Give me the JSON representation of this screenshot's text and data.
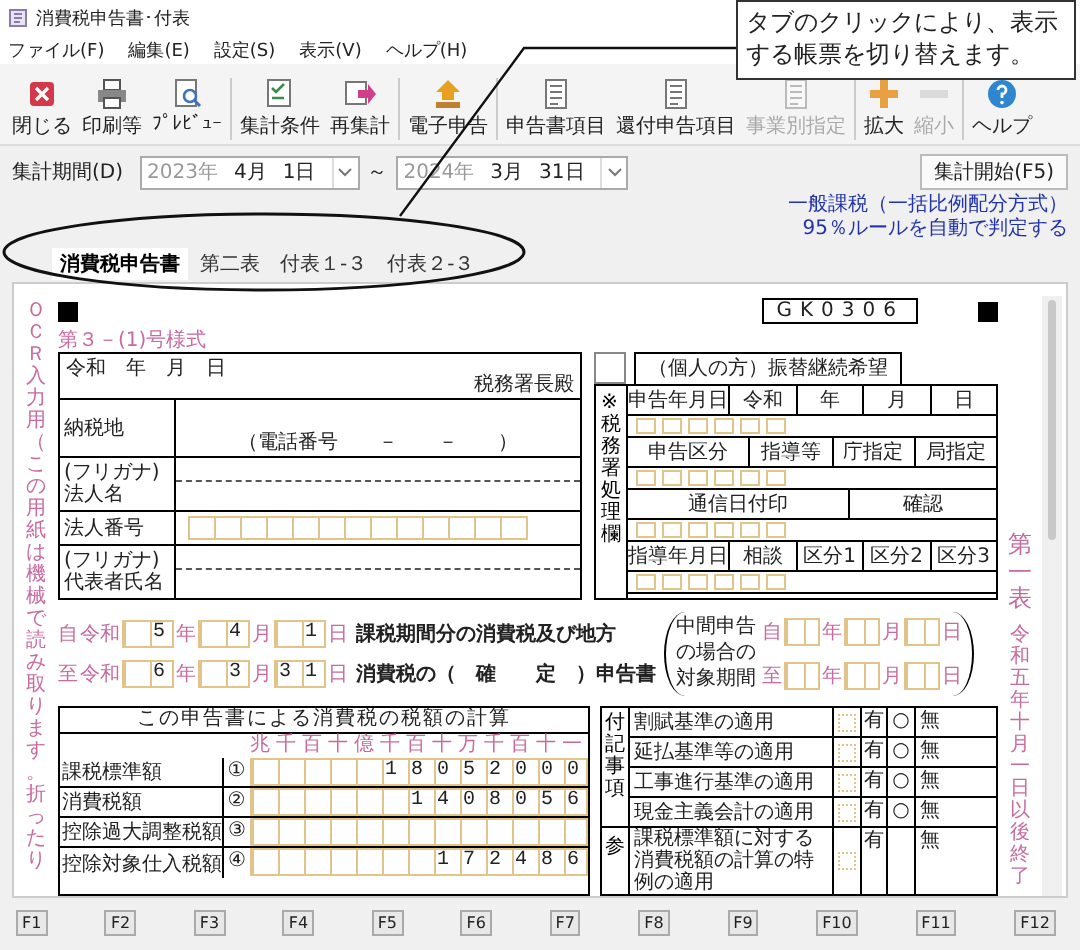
{
  "window": {
    "title": "消費税申告書･付表"
  },
  "menu": [
    "ファイル(F)",
    "編集(E)",
    "設定(S)",
    "表示(V)",
    "ヘルプ(H)"
  ],
  "toolbar": [
    [
      {
        "label": "閉じる",
        "kind": "close",
        "disabled": false
      },
      {
        "label": "印刷等",
        "kind": "printer",
        "disabled": false
      },
      {
        "label": "ﾌﾟﾚﾋﾞｭｰ",
        "kind": "preview",
        "disabled": false
      }
    ],
    [
      {
        "label": "集計条件",
        "kind": "settings",
        "disabled": false
      },
      {
        "label": "再集計",
        "kind": "recalc",
        "disabled": false
      }
    ],
    [
      {
        "label": "電子申告",
        "kind": "upload",
        "disabled": false
      }
    ],
    [
      {
        "label": "申告書項目",
        "kind": "list",
        "disabled": false
      },
      {
        "label": "還付申告項目",
        "kind": "list",
        "disabled": false
      },
      {
        "label": "事業別指定",
        "kind": "list",
        "disabled": true
      }
    ],
    [
      {
        "label": "拡大",
        "kind": "plus",
        "disabled": false
      },
      {
        "label": "縮小",
        "kind": "minus",
        "disabled": true
      }
    ],
    [
      {
        "label": "ヘルプ",
        "kind": "help",
        "disabled": false
      }
    ]
  ],
  "period": {
    "label": "集計期間(D)",
    "from": {
      "year": "2023年",
      "month": "4月",
      "day": "1日"
    },
    "separator": "～",
    "to": {
      "year": "2024年",
      "month": "3月",
      "day": "31日"
    }
  },
  "aggregate_button": "集計開始(F5)",
  "mode_note": [
    "一般課税（一括比例配分方式）",
    "95％ルールを自動で判定する"
  ],
  "tabs": [
    {
      "label": "消費税申告書",
      "selected": true
    },
    {
      "label": "第二表",
      "selected": false
    },
    {
      "label": "付表１-３",
      "selected": false
    },
    {
      "label": "付表２-３",
      "selected": false
    }
  ],
  "callout": [
    "タブのクリックにより、表示",
    "する帳票を切り替えます。"
  ],
  "form": {
    "code": "GK0306",
    "form_number": "第３－(1)号様式",
    "ocr_note": "ＯＣＲ入力用（この用紙は機械で読み取ります。折ったり",
    "side_title": "第一表",
    "side_period": "令和五年十月一日以後終了",
    "filer": {
      "date_label": "令和　年　月　日",
      "office_suffix": "税務署長殿",
      "rows": [
        {
          "kind": "address",
          "label": "納税地",
          "note": "（電話番号　　－　　－　　）"
        },
        {
          "kind": "name",
          "kana": "(フリガナ)",
          "label": "法人名"
        },
        {
          "kind": "number",
          "label": "法人番号"
        },
        {
          "kind": "name",
          "kana": "(フリガナ)",
          "label": "代表者氏名"
        }
      ]
    },
    "office": {
      "transfer": "（個人の方）振替継続希望",
      "side": "※税務署処理欄",
      "sections": [
        {
          "cells": [
            "申告年月日",
            "令和",
            "年",
            "月",
            "日"
          ]
        },
        {
          "cells": [
            "申告区分",
            "指導等",
            "庁指定",
            "局指定"
          ]
        },
        {
          "cells": [
            "通信日付印",
            "確認"
          ]
        },
        {
          "cells": [
            "指導年月日",
            "相談",
            "区分1",
            "区分2",
            "区分3"
          ]
        }
      ]
    },
    "period": [
      {
        "prefix": "自",
        "era": "令和",
        "parts": [
          {
            "value": "5",
            "unit": "年"
          },
          {
            "value": "4",
            "unit": "月"
          },
          {
            "value": "1",
            "unit": "日"
          }
        ]
      },
      {
        "prefix": "至",
        "era": "令和",
        "parts": [
          {
            "value": "6",
            "unit": "年"
          },
          {
            "value": "3",
            "unit": "月"
          },
          {
            "value": "31",
            "unit": "日"
          }
        ]
      }
    ],
    "title_lines": [
      "課税期間分の消費税及び地方",
      "消費税の（　確　　定　）申告書"
    ],
    "interim": {
      "labels": [
        "中間申告",
        "の場合の",
        "対象期間"
      ],
      "rows": [
        {
          "prefix": "自",
          "units": [
            "年",
            "月",
            "日"
          ]
        },
        {
          "prefix": "至",
          "units": [
            "年",
            "月",
            "日"
          ]
        }
      ]
    },
    "calc": {
      "title": "この申告書による消費税の税額の計算",
      "units": "兆千百十億千百十万千百十一",
      "rows": [
        {
          "label": "課税標準額",
          "mark": "①",
          "value": "18052000"
        },
        {
          "label": "消費税額",
          "mark": "②",
          "value": "1408056"
        },
        {
          "label": "控除過大調整税額",
          "mark": "③",
          "value": ""
        },
        {
          "label": "控除対象仕入税額",
          "mark": "④",
          "value": "172486"
        }
      ]
    },
    "notes": {
      "side": "付記事項",
      "reference_side": "参",
      "rows": [
        {
          "label": "割賦基準の適用",
          "yes": "有",
          "mark": "○",
          "no": "無"
        },
        {
          "label": "延払基準等の適用",
          "yes": "有",
          "mark": "○",
          "no": "無"
        },
        {
          "label": "工事進行基準の適用",
          "yes": "有",
          "mark": "○",
          "no": "無"
        },
        {
          "label": "現金主義会計の適用",
          "yes": "有",
          "mark": "○",
          "no": "無"
        },
        {
          "label": "課税標準額に対する消費税額の計算の特例の適用",
          "yes": "有",
          "no": "無"
        }
      ]
    }
  },
  "function_keys": [
    "F1",
    "F2",
    "F3",
    "F4",
    "F5",
    "F6",
    "F7",
    "F8",
    "F9",
    "F10",
    "F11",
    "F12"
  ]
}
